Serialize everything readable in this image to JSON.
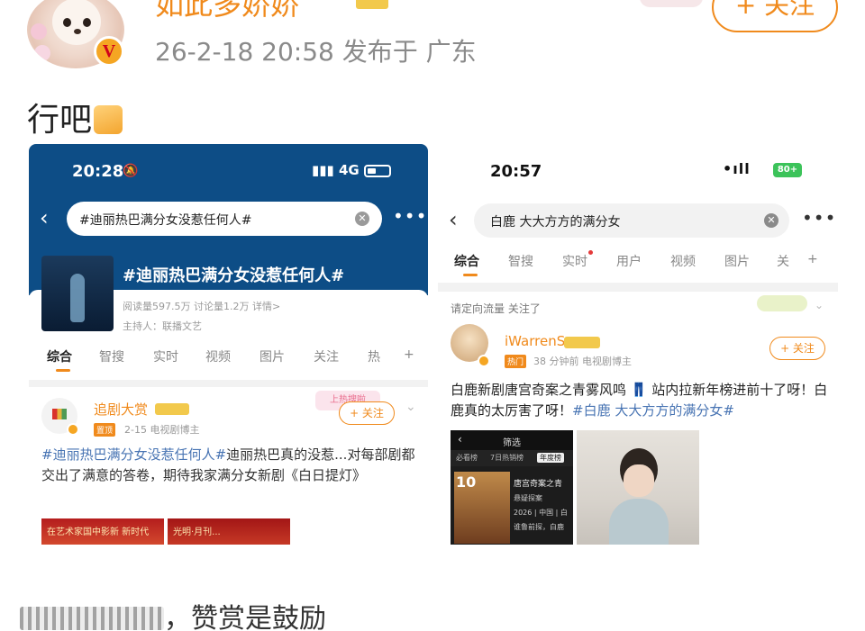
{
  "post": {
    "username": "如此多娇娇",
    "meta": "26-2-18 20:58  发布于 广东",
    "follow_label": "+ 关注",
    "text": "行吧",
    "reward_text": "，赞赏是鼓励"
  },
  "left_screenshot": {
    "time": "20:28",
    "mute_icon": "🔕",
    "status": "4G",
    "search_query": "#迪丽热巴满分女没惹任何人#",
    "topic_title": "#迪丽热巴满分女没惹任何人#",
    "stats": "阅读量597.5万  讨论量1.2万  详情>",
    "host": "主持人：联播文艺",
    "tabs": [
      "综合",
      "智搜",
      "实时",
      "视频",
      "图片",
      "关注",
      "热",
      "+"
    ],
    "post": {
      "author": "追剧大赏",
      "badge": "置顶",
      "meta": "2-15  电视剧博主",
      "follow_label": "+ 关注",
      "hot_label": "上热搜啦",
      "text_tag": "#迪丽热巴满分女没惹任何人#",
      "text_body": "迪丽热巴真的没惹...对每部剧都交出了满意的答卷，期待我家满分女新剧《白日提灯》",
      "img1_text": "在艺术家国中影新 新时代",
      "img2_text": "光明·月刊..."
    }
  },
  "right_screenshot": {
    "time": "20:57",
    "status": "•ıll",
    "battery": "80+",
    "search_query": "白鹿 大大方方的满分女",
    "tabs": [
      "综合",
      "智搜",
      "实时",
      "用户",
      "视频",
      "图片",
      "关",
      "+"
    ],
    "rec": "请定向流量 关注了",
    "post": {
      "author": "iWarrenS",
      "badge": "热门",
      "meta": "38 分钟前  电视剧博主",
      "follow_label": "+ 关注",
      "text_body": "白鹿新剧唐宫奇案之青雾风鸣 👖 站内拉新年榜进前十了呀！白鹿真的太厉害了呀！",
      "text_tag": "#白鹿 大大方方的满分女#",
      "img1": {
        "title": "筛选",
        "tabs": [
          "必看榜",
          "7日热销榜",
          "年度榜"
        ],
        "rank": "10",
        "lines": [
          "唐宫奇案之青",
          "悬疑探案",
          "2026 | 中国 | 白",
          "谁鲁前探，白鹿"
        ]
      }
    }
  },
  "colors": {
    "accent": "#f08a1c",
    "link": "#4874b3",
    "topic_bg": "#0d4d86"
  }
}
